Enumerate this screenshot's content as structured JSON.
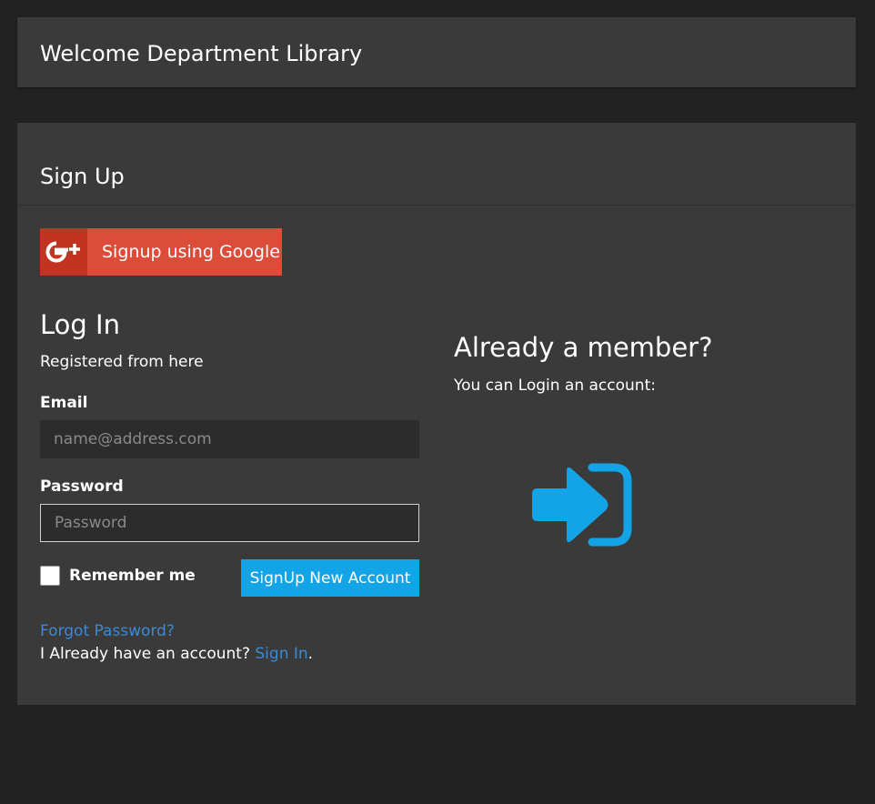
{
  "header": {
    "title": "Welcome Department Library"
  },
  "panel": {
    "title": "Sign Up"
  },
  "google_signup": {
    "label": "Signup using Google",
    "icon": "google-plus-icon",
    "color": "#dd4b39"
  },
  "login": {
    "title": "Log In",
    "subtitle": "Registered from here",
    "email_label": "Email",
    "email_placeholder": "name@address.com",
    "email_value": "",
    "password_label": "Password",
    "password_placeholder": "Password",
    "password_value": "",
    "remember_label": "Remember me",
    "remember_checked": false,
    "signup_button": "SignUp New Account",
    "forgot_link": "Forgot Password?",
    "already_text": "I Already have an account?",
    "signin_link": "Sign In",
    "signin_suffix": "."
  },
  "member": {
    "title": "Already a member?",
    "subtitle": "You can Login an account:",
    "icon": "sign-in-icon"
  },
  "colors": {
    "page_background": "#222222",
    "panel_background": "#3a3a3a",
    "accent": "#13a4e8",
    "link": "#3b8ad6"
  }
}
